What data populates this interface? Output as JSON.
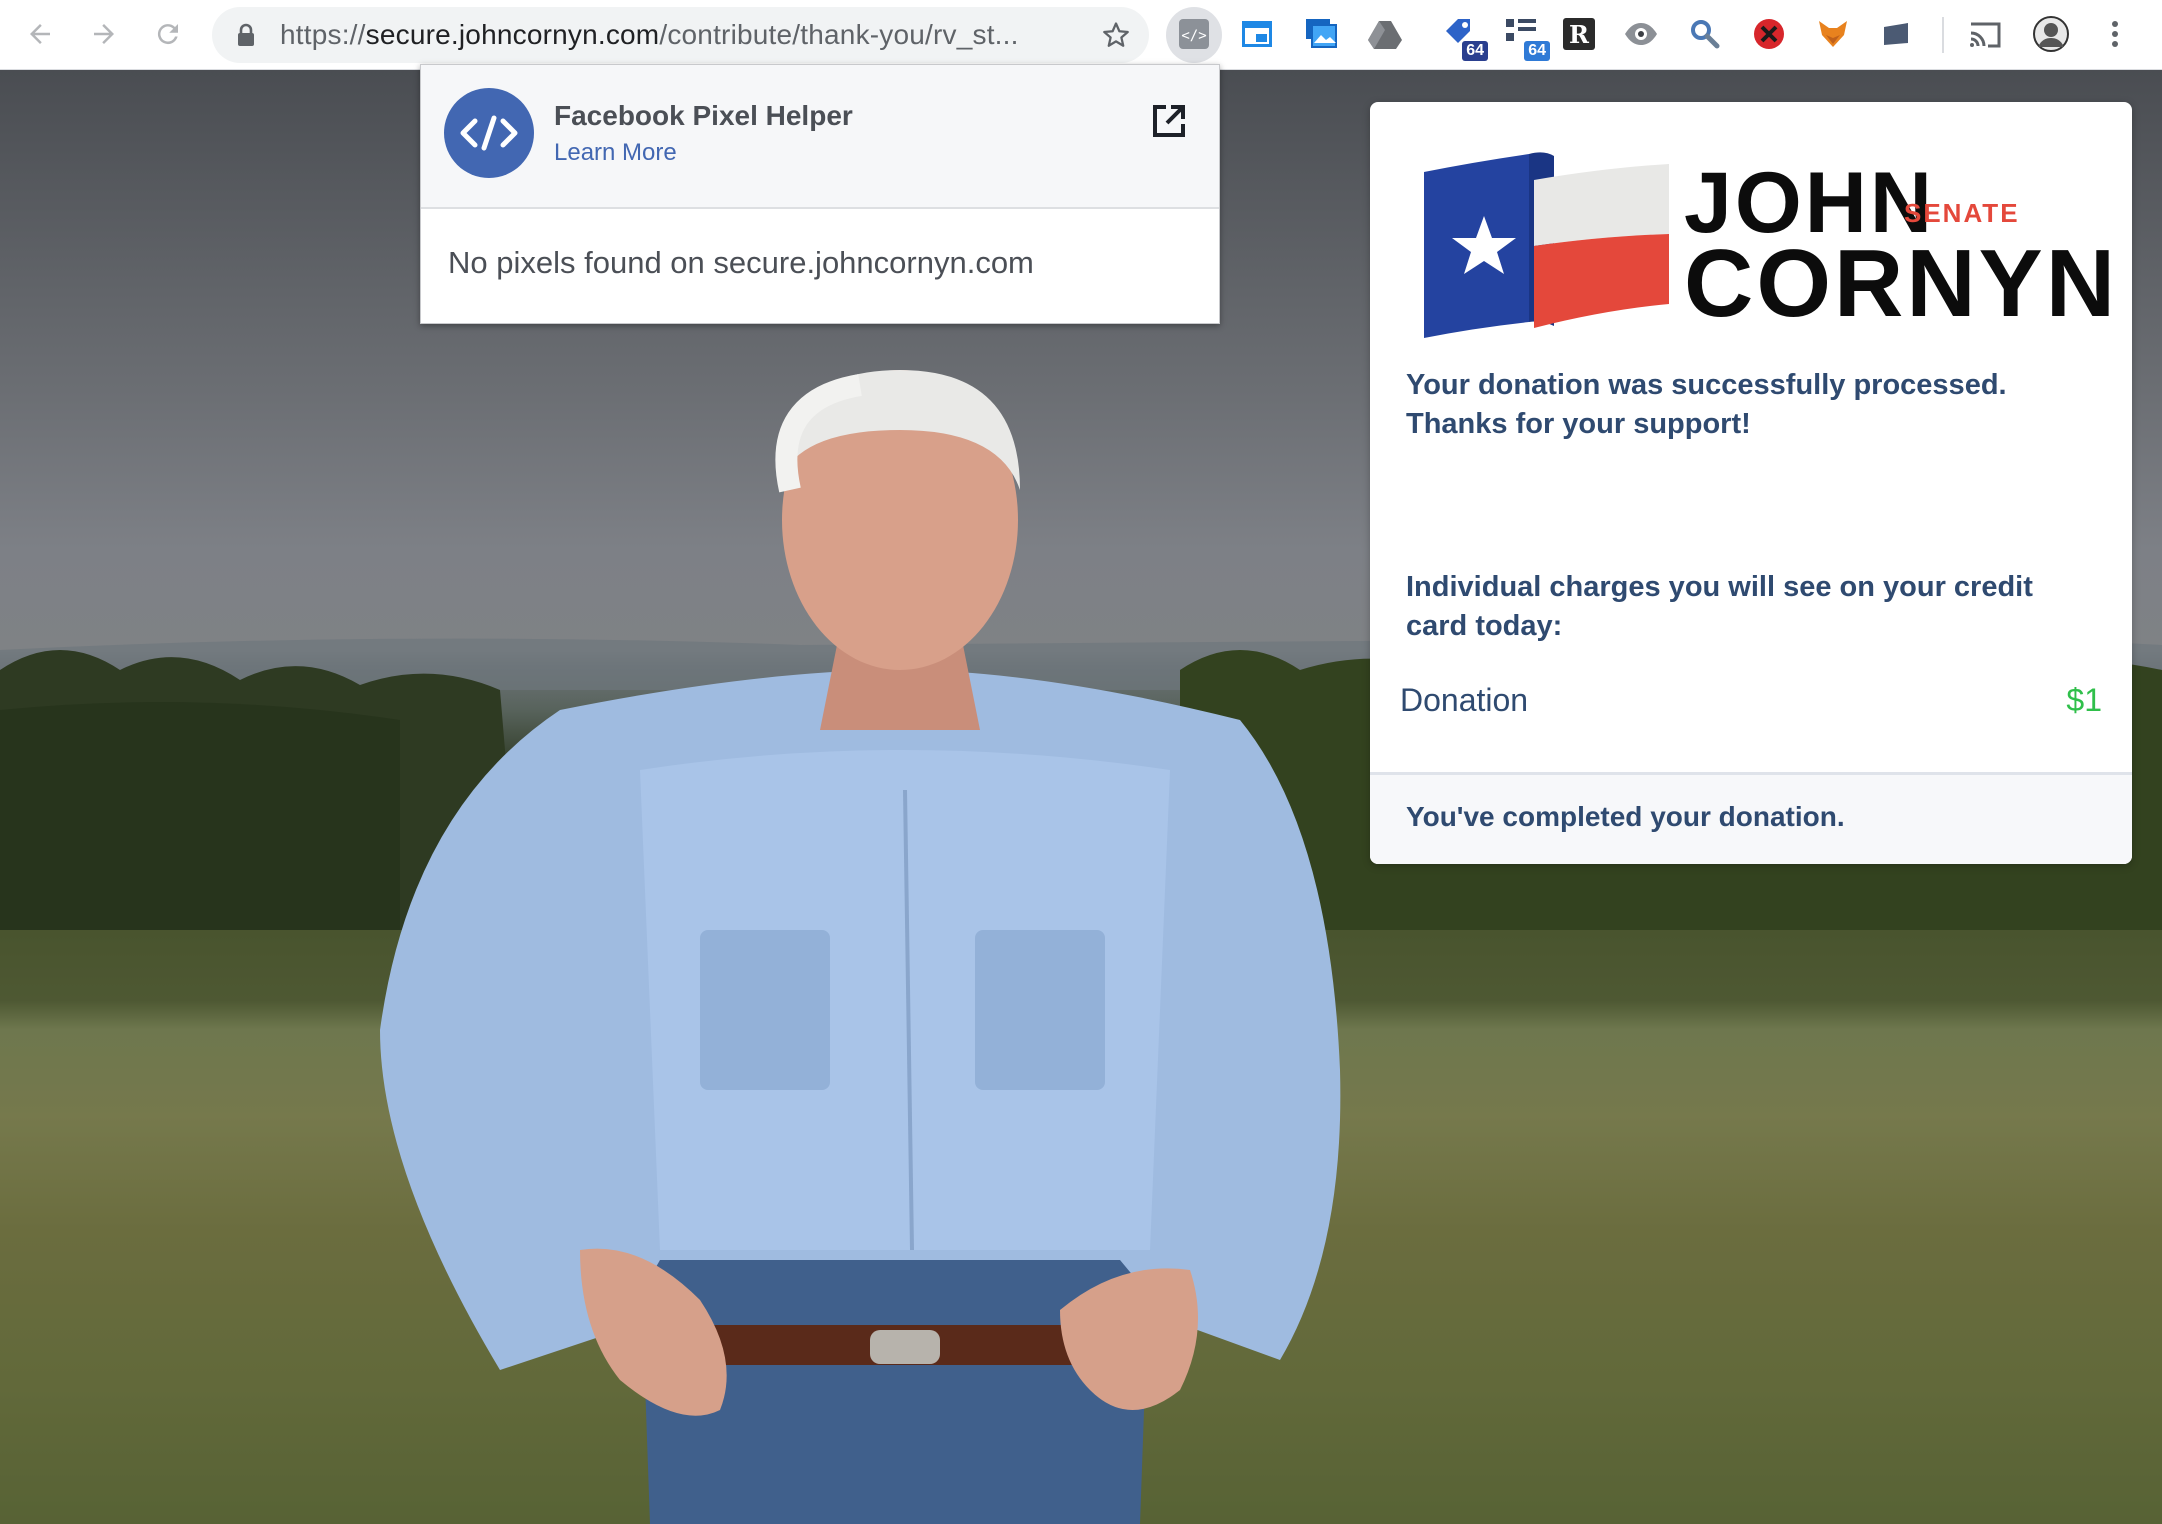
{
  "browser": {
    "url_host": "secure.johncornyn.com",
    "url_scheme": "https://",
    "url_path": "/contribute/thank-you/rv_st...",
    "extension_badges": [
      "64",
      "64"
    ]
  },
  "pixel_helper": {
    "title": "Facebook Pixel Helper",
    "learn_more": "Learn More",
    "message": "No pixels found on secure.johncornyn.com"
  },
  "card": {
    "logo": {
      "first_name": "JOHN",
      "office": "SENATE",
      "last_name": "CORNYN"
    },
    "success_message": "Your donation was successfully processed. Thanks for your support!",
    "charges_heading": "Individual charges you will see on your credit card today:",
    "line_item_label": "Donation",
    "line_item_amount": "$1",
    "footer": "You've completed your donation."
  },
  "colors": {
    "brand_navy": "#2f4a70",
    "amount_green": "#2fbf4a",
    "senate_red": "#e4483b",
    "facebook_blue": "#4267b2"
  }
}
